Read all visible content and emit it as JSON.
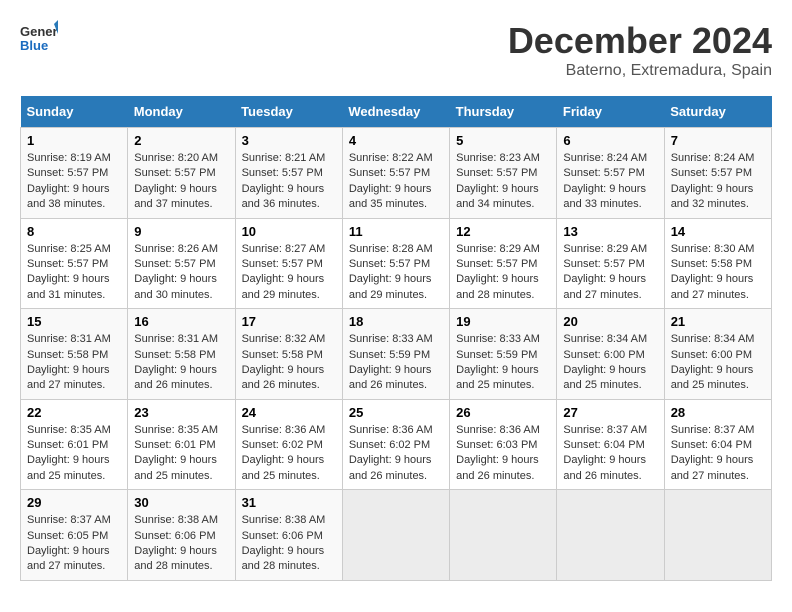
{
  "logo": {
    "line1": "General",
    "line2": "Blue"
  },
  "title": "December 2024",
  "subtitle": "Baterno, Extremadura, Spain",
  "days_of_week": [
    "Sunday",
    "Monday",
    "Tuesday",
    "Wednesday",
    "Thursday",
    "Friday",
    "Saturday"
  ],
  "weeks": [
    [
      {
        "day": "1",
        "sunrise": "8:19 AM",
        "sunset": "5:57 PM",
        "daylight": "9 hours and 38 minutes."
      },
      {
        "day": "2",
        "sunrise": "8:20 AM",
        "sunset": "5:57 PM",
        "daylight": "9 hours and 37 minutes."
      },
      {
        "day": "3",
        "sunrise": "8:21 AM",
        "sunset": "5:57 PM",
        "daylight": "9 hours and 36 minutes."
      },
      {
        "day": "4",
        "sunrise": "8:22 AM",
        "sunset": "5:57 PM",
        "daylight": "9 hours and 35 minutes."
      },
      {
        "day": "5",
        "sunrise": "8:23 AM",
        "sunset": "5:57 PM",
        "daylight": "9 hours and 34 minutes."
      },
      {
        "day": "6",
        "sunrise": "8:24 AM",
        "sunset": "5:57 PM",
        "daylight": "9 hours and 33 minutes."
      },
      {
        "day": "7",
        "sunrise": "8:24 AM",
        "sunset": "5:57 PM",
        "daylight": "9 hours and 32 minutes."
      }
    ],
    [
      {
        "day": "8",
        "sunrise": "8:25 AM",
        "sunset": "5:57 PM",
        "daylight": "9 hours and 31 minutes."
      },
      {
        "day": "9",
        "sunrise": "8:26 AM",
        "sunset": "5:57 PM",
        "daylight": "9 hours and 30 minutes."
      },
      {
        "day": "10",
        "sunrise": "8:27 AM",
        "sunset": "5:57 PM",
        "daylight": "9 hours and 29 minutes."
      },
      {
        "day": "11",
        "sunrise": "8:28 AM",
        "sunset": "5:57 PM",
        "daylight": "9 hours and 29 minutes."
      },
      {
        "day": "12",
        "sunrise": "8:29 AM",
        "sunset": "5:57 PM",
        "daylight": "9 hours and 28 minutes."
      },
      {
        "day": "13",
        "sunrise": "8:29 AM",
        "sunset": "5:57 PM",
        "daylight": "9 hours and 27 minutes."
      },
      {
        "day": "14",
        "sunrise": "8:30 AM",
        "sunset": "5:58 PM",
        "daylight": "9 hours and 27 minutes."
      }
    ],
    [
      {
        "day": "15",
        "sunrise": "8:31 AM",
        "sunset": "5:58 PM",
        "daylight": "9 hours and 27 minutes."
      },
      {
        "day": "16",
        "sunrise": "8:31 AM",
        "sunset": "5:58 PM",
        "daylight": "9 hours and 26 minutes."
      },
      {
        "day": "17",
        "sunrise": "8:32 AM",
        "sunset": "5:58 PM",
        "daylight": "9 hours and 26 minutes."
      },
      {
        "day": "18",
        "sunrise": "8:33 AM",
        "sunset": "5:59 PM",
        "daylight": "9 hours and 26 minutes."
      },
      {
        "day": "19",
        "sunrise": "8:33 AM",
        "sunset": "5:59 PM",
        "daylight": "9 hours and 25 minutes."
      },
      {
        "day": "20",
        "sunrise": "8:34 AM",
        "sunset": "6:00 PM",
        "daylight": "9 hours and 25 minutes."
      },
      {
        "day": "21",
        "sunrise": "8:34 AM",
        "sunset": "6:00 PM",
        "daylight": "9 hours and 25 minutes."
      }
    ],
    [
      {
        "day": "22",
        "sunrise": "8:35 AM",
        "sunset": "6:01 PM",
        "daylight": "9 hours and 25 minutes."
      },
      {
        "day": "23",
        "sunrise": "8:35 AM",
        "sunset": "6:01 PM",
        "daylight": "9 hours and 25 minutes."
      },
      {
        "day": "24",
        "sunrise": "8:36 AM",
        "sunset": "6:02 PM",
        "daylight": "9 hours and 25 minutes."
      },
      {
        "day": "25",
        "sunrise": "8:36 AM",
        "sunset": "6:02 PM",
        "daylight": "9 hours and 26 minutes."
      },
      {
        "day": "26",
        "sunrise": "8:36 AM",
        "sunset": "6:03 PM",
        "daylight": "9 hours and 26 minutes."
      },
      {
        "day": "27",
        "sunrise": "8:37 AM",
        "sunset": "6:04 PM",
        "daylight": "9 hours and 26 minutes."
      },
      {
        "day": "28",
        "sunrise": "8:37 AM",
        "sunset": "6:04 PM",
        "daylight": "9 hours and 27 minutes."
      }
    ],
    [
      {
        "day": "29",
        "sunrise": "8:37 AM",
        "sunset": "6:05 PM",
        "daylight": "9 hours and 27 minutes."
      },
      {
        "day": "30",
        "sunrise": "8:38 AM",
        "sunset": "6:06 PM",
        "daylight": "9 hours and 28 minutes."
      },
      {
        "day": "31",
        "sunrise": "8:38 AM",
        "sunset": "6:06 PM",
        "daylight": "9 hours and 28 minutes."
      },
      null,
      null,
      null,
      null
    ]
  ]
}
